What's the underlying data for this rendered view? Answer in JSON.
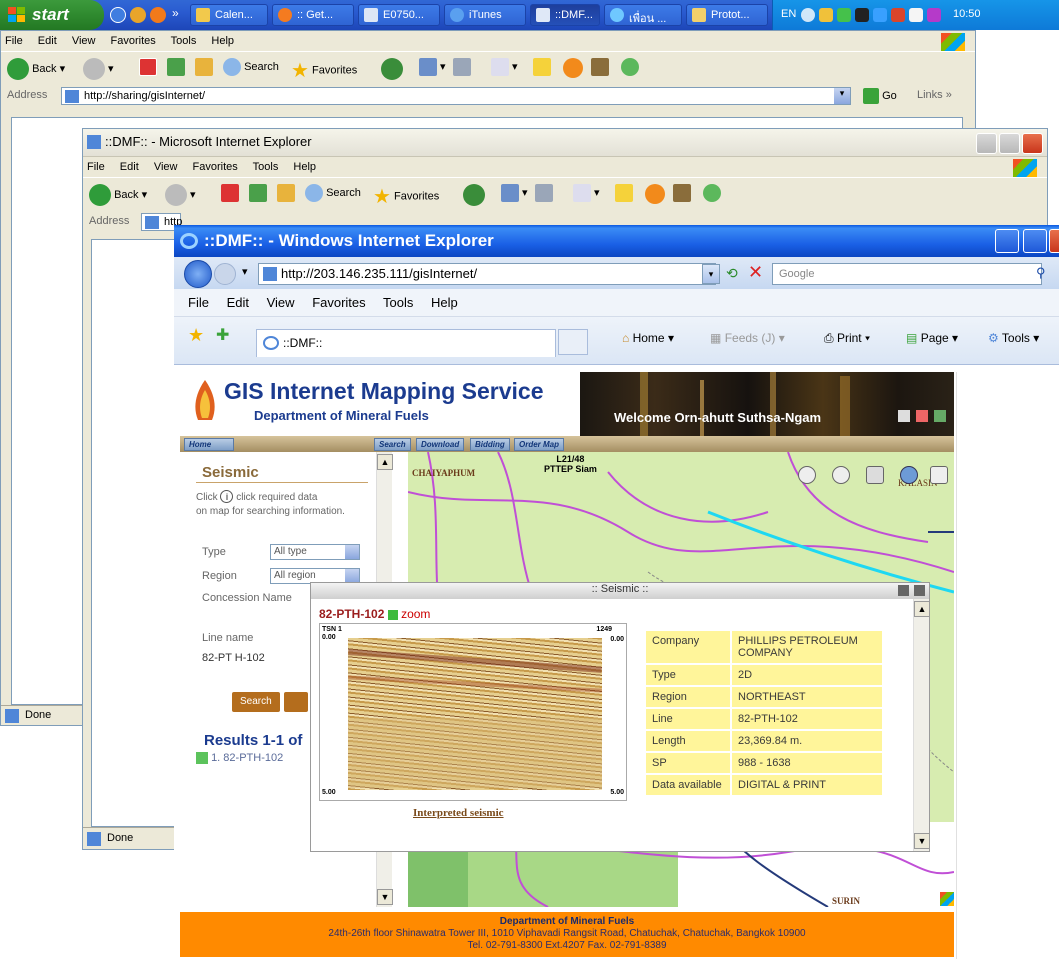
{
  "taskbar": {
    "start_label": "start",
    "buttons": [
      "Calen...",
      ":: Get...",
      "E0750...",
      "iTunes",
      "::DMF...",
      "เพื่อน ...",
      "Protot..."
    ],
    "lang": "EN",
    "clock": "10:50"
  },
  "win1": {
    "menu": [
      "File",
      "Edit",
      "View",
      "Favorites",
      "Tools",
      "Help"
    ],
    "back": "Back",
    "search": "Search",
    "favorites": "Favorites",
    "address_label": "Address",
    "address": "http://sharing/gisInternet/",
    "go": "Go",
    "links": "Links",
    "status": "Done"
  },
  "win2": {
    "title": "::DMF:: - Microsoft Internet Explorer",
    "menu": [
      "File",
      "Edit",
      "View",
      "Favorites",
      "Tools",
      "Help"
    ],
    "back": "Back",
    "search": "Search",
    "favorites": "Favorites",
    "address_label": "Address",
    "address": "http",
    "status": "Done"
  },
  "win3": {
    "title": "::DMF:: - Windows Internet Explorer",
    "address": "http://203.146.235.111/gisInternet/",
    "search_placeholder": "Google",
    "menu": [
      "File",
      "Edit",
      "View",
      "Favorites",
      "Tools",
      "Help"
    ],
    "tab": "::DMF::",
    "cmd": {
      "home": "Home",
      "feeds": "Feeds (J)",
      "print": "Print",
      "page": "Page",
      "tools": "Tools"
    }
  },
  "page": {
    "title": "GIS Internet Mapping Service",
    "subtitle": "Department of Mineral Fuels",
    "welcome": "Welcome Orn-ahutt Suthsa-Ngam",
    "nav": {
      "home": "Home",
      "search": "Search",
      "download": "Download",
      "bidding": "Bidding",
      "order": "Order Map"
    },
    "left": {
      "heading": "Seismic",
      "hint1": "Click",
      "hint2": "click required data",
      "hint3": "on map for searching information.",
      "type_label": "Type",
      "type_value": "All type",
      "region_label": "Region",
      "region_value": "All region",
      "concession_label": "Concession Name",
      "line_label": "Line name",
      "line_value": "82-PT H-102",
      "search_btn": "Search",
      "results": "Results 1-1 of",
      "result_item": "1. 82-PTH-102"
    },
    "map": {
      "l1": "L21/48",
      "l2": "PTTEP Siam",
      "chaiyaphum": "CHAIYAPHUM",
      "kalasin": "KALASIN",
      "surin": "SURIN"
    },
    "popup": {
      "title": ":: Seismic ::",
      "line_name": "82-PTH-102",
      "zoom": "zoom",
      "tsn": "TSN 1",
      "sp_end": "1249",
      "t0": "0.00",
      "t5": "5.00",
      "interpreted": "Interpreted seismic",
      "rows": [
        {
          "k": "Company",
          "v": "PHILLIPS PETROLEUM COMPANY"
        },
        {
          "k": "Type",
          "v": "2D"
        },
        {
          "k": "Region",
          "v": "NORTHEAST"
        },
        {
          "k": "Line",
          "v": "82-PTH-102"
        },
        {
          "k": "Length",
          "v": "23,369.84 m."
        },
        {
          "k": "SP",
          "v": "988 - 1638"
        },
        {
          "k": "Data available",
          "v": "DIGITAL & PRINT"
        }
      ]
    },
    "footer": {
      "line1": "Department of Mineral Fuels",
      "line2": "24th-26th floor Shinawatra Tower III, 1010 Viphavadi Rangsit Road, Chatuchak, Chatuchak, Bangkok 10900",
      "line3": "Tel. 02-791-8300 Ext.4207 Fax. 02-791-8389"
    }
  }
}
